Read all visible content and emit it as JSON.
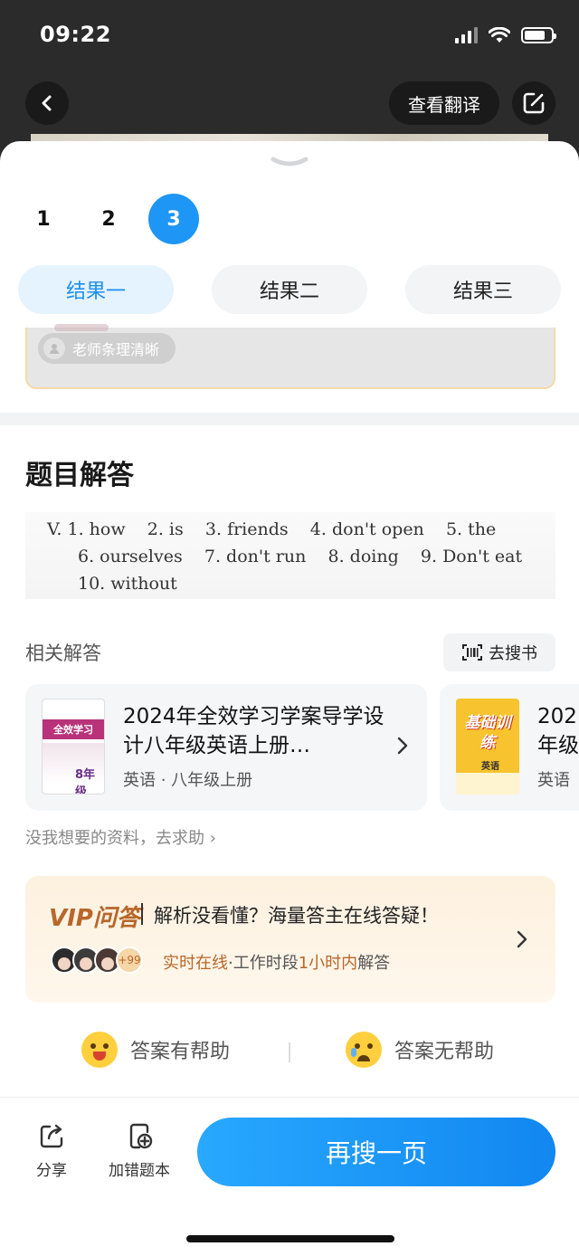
{
  "status_bar": {
    "time": "09:22"
  },
  "header": {
    "translate_label": "查看翻译"
  },
  "pages": [
    "1",
    "2",
    "3"
  ],
  "active_page": 2,
  "result_tabs": [
    "结果一",
    "结果二",
    "结果三"
  ],
  "teacher_card": {
    "badge": "老师条理清晰"
  },
  "answer_section": {
    "title": "题目解答",
    "lines": [
      "V. 1. how    2. is    3. friends    4. don't open    5. the",
      "6. ourselves    7. don't run    8. doing    9. Don't eat",
      "10. without"
    ]
  },
  "related": {
    "title": "相关解答",
    "search_book_label": "去搜书",
    "books": [
      {
        "title": "2024年全效学习学案导学设计八年级英语上册…",
        "meta": "英语 · 八年级上册",
        "cover_text": "全效学习",
        "cover_grade": "8年级"
      },
      {
        "title": "202年级",
        "meta": "英语",
        "cover_text": "基础训练",
        "cover_sub": "英语"
      }
    ],
    "help_link": "没我想要的资料，去求助 ›"
  },
  "vip": {
    "logo": "VIP问答",
    "headline": "解析没看懂？海量答主在线答疑！",
    "avatar_more": "+99",
    "status_prefix": "实时在线",
    "status_mid": "·工作时段",
    "status_highlight": "1小时内",
    "status_suffix": "解答"
  },
  "feedback": {
    "helpful": "答案有帮助",
    "not_helpful": "答案无帮助"
  },
  "bottom_bar": {
    "share": "分享",
    "add_wrong": "加错题本",
    "research": "再搜一页"
  },
  "colors": {
    "accent": "#1e96f5",
    "vip": "#b8672a"
  }
}
